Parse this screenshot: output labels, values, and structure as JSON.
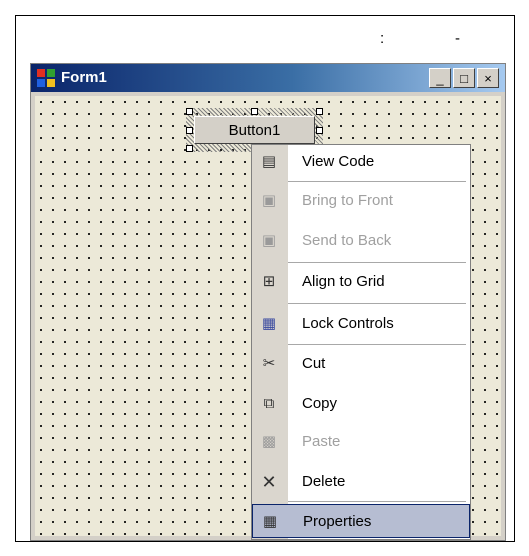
{
  "top_text": {
    "left": ":",
    "right": "-"
  },
  "window": {
    "title": "Form1",
    "controls": {
      "minimize": "_",
      "maximize": "□",
      "close": "×"
    }
  },
  "button": {
    "label": "Button1"
  },
  "context_menu": {
    "items": [
      {
        "label": "View Code",
        "icon": "view-code-icon",
        "enabled": true
      },
      {
        "label": "Bring to Front",
        "icon": "bring-front-icon",
        "enabled": false
      },
      {
        "label": "Send to Back",
        "icon": "send-back-icon",
        "enabled": false
      },
      {
        "label": "Align to Grid",
        "icon": "align-grid-icon",
        "enabled": true
      },
      {
        "label": "Lock Controls",
        "icon": "lock-icon",
        "enabled": true
      },
      {
        "label": "Cut",
        "icon": "scissors-icon",
        "enabled": true
      },
      {
        "label": "Copy",
        "icon": "copy-icon",
        "enabled": true
      },
      {
        "label": "Paste",
        "icon": "paste-icon",
        "enabled": false
      },
      {
        "label": "Delete",
        "icon": "delete-icon",
        "enabled": true
      },
      {
        "label": "Properties",
        "icon": "properties-icon",
        "enabled": true,
        "highlighted": true
      }
    ]
  },
  "colors": {
    "titlebar": "#0a246a",
    "highlight": "#b6bdd2",
    "disabled_text": "#a0a0a0"
  }
}
